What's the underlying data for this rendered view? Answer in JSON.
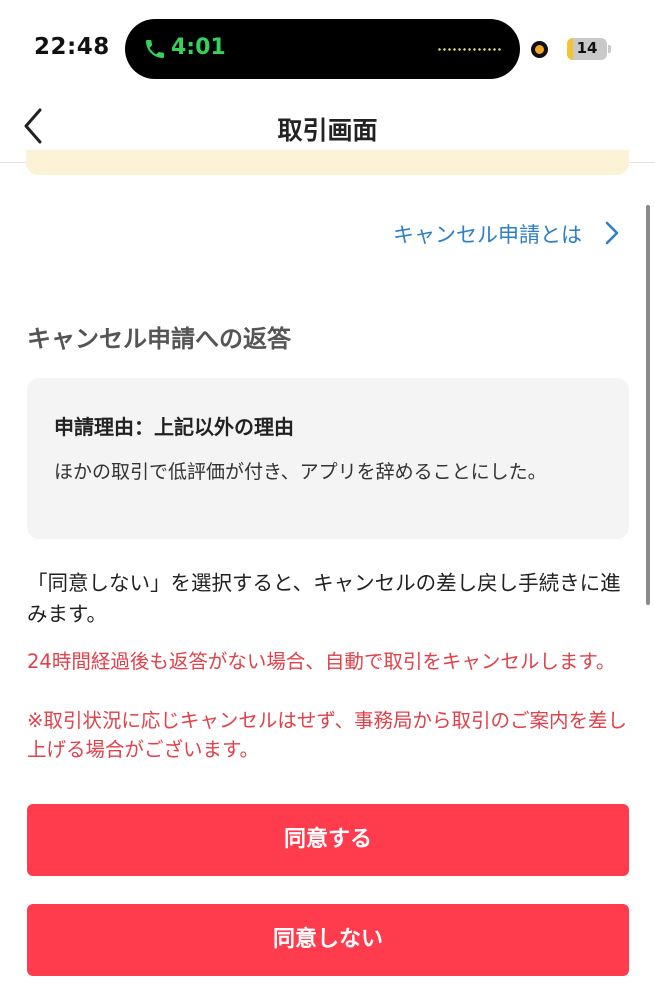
{
  "status_bar": {
    "time": "22:48",
    "call_timer": "4:01",
    "battery_level": "14",
    "battery_fraction": 0.14,
    "icons": [
      "phone-icon",
      "orange-indicator-dot",
      "battery-icon"
    ]
  },
  "nav": {
    "back_icon": "chevron-left-icon",
    "title": "取引画面"
  },
  "help_link": {
    "label": "キャンセル申請とは",
    "icon": "chevron-right-icon"
  },
  "section": {
    "title": "キャンセル申請への返答"
  },
  "reason_card": {
    "title": "申請理由：上記以外の理由",
    "body": "ほかの取引で低評価が付き、アプリを辞めることにした。"
  },
  "explanation": "「同意しない」を選択すると、キャンセルの差し戻し手続きに進みます。",
  "warnings": [
    "24時間経過後も返答がない場合、自動で取引をキャンセルします。",
    "※取引状況に応じキャンセルはせず、事務局から取引のご案内を差し上げる場合がございます。"
  ],
  "buttons": {
    "agree": "同意する",
    "disagree": "同意しない"
  },
  "colors": {
    "primary_red": "#ff3b4e",
    "warning_text": "#e0414a",
    "link_blue": "#2d7fc7",
    "notice_yellow": "#fcf3d6",
    "card_gray": "#f4f4f4",
    "call_green": "#35d158"
  }
}
